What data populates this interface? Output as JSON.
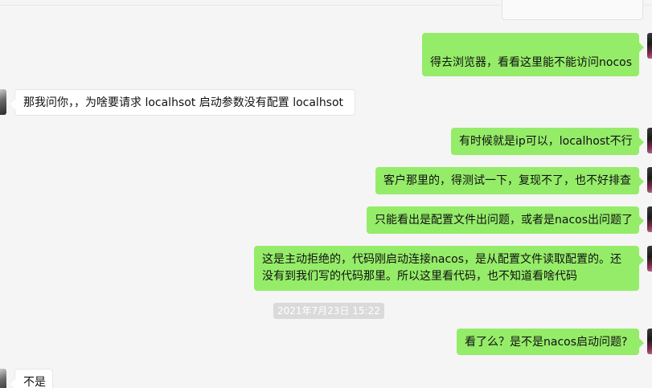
{
  "messages": [
    {
      "id": 1,
      "sender": "me",
      "text": "得去浏览器，看看这里能不能访问nocos"
    },
    {
      "id": 2,
      "sender": "other",
      "text": "那我问你，，为啥要请求 localhsot 启动参数没有配置 localhsot"
    },
    {
      "id": 3,
      "sender": "me",
      "text": "有时候就是ip可以，localhost不行"
    },
    {
      "id": 4,
      "sender": "me",
      "text": "客户那里的，得测试一下，复现不了，也不好排查"
    },
    {
      "id": 5,
      "sender": "me",
      "text": "只能看出是配置文件出问题，或者是nacos出问题了"
    },
    {
      "id": 6,
      "sender": "me",
      "text": "这是主动拒绝的，代码刚启动连接nacos，是从配置文件读取配置的。还没有到我们写的代码那里。所以这里看代码，也不知道看啥代码"
    },
    {
      "id": 7,
      "sender": "me",
      "text": "看了么？是不是nacos启动问题?"
    },
    {
      "id": 8,
      "sender": "other",
      "text": "不是"
    }
  ],
  "timestamp": "2021年7月23日 15:22",
  "colors": {
    "outgoing_bubble": "#95ec69",
    "incoming_bubble": "#ffffff",
    "background": "#f5f5f5",
    "timestamp_bg": "#dadada"
  }
}
